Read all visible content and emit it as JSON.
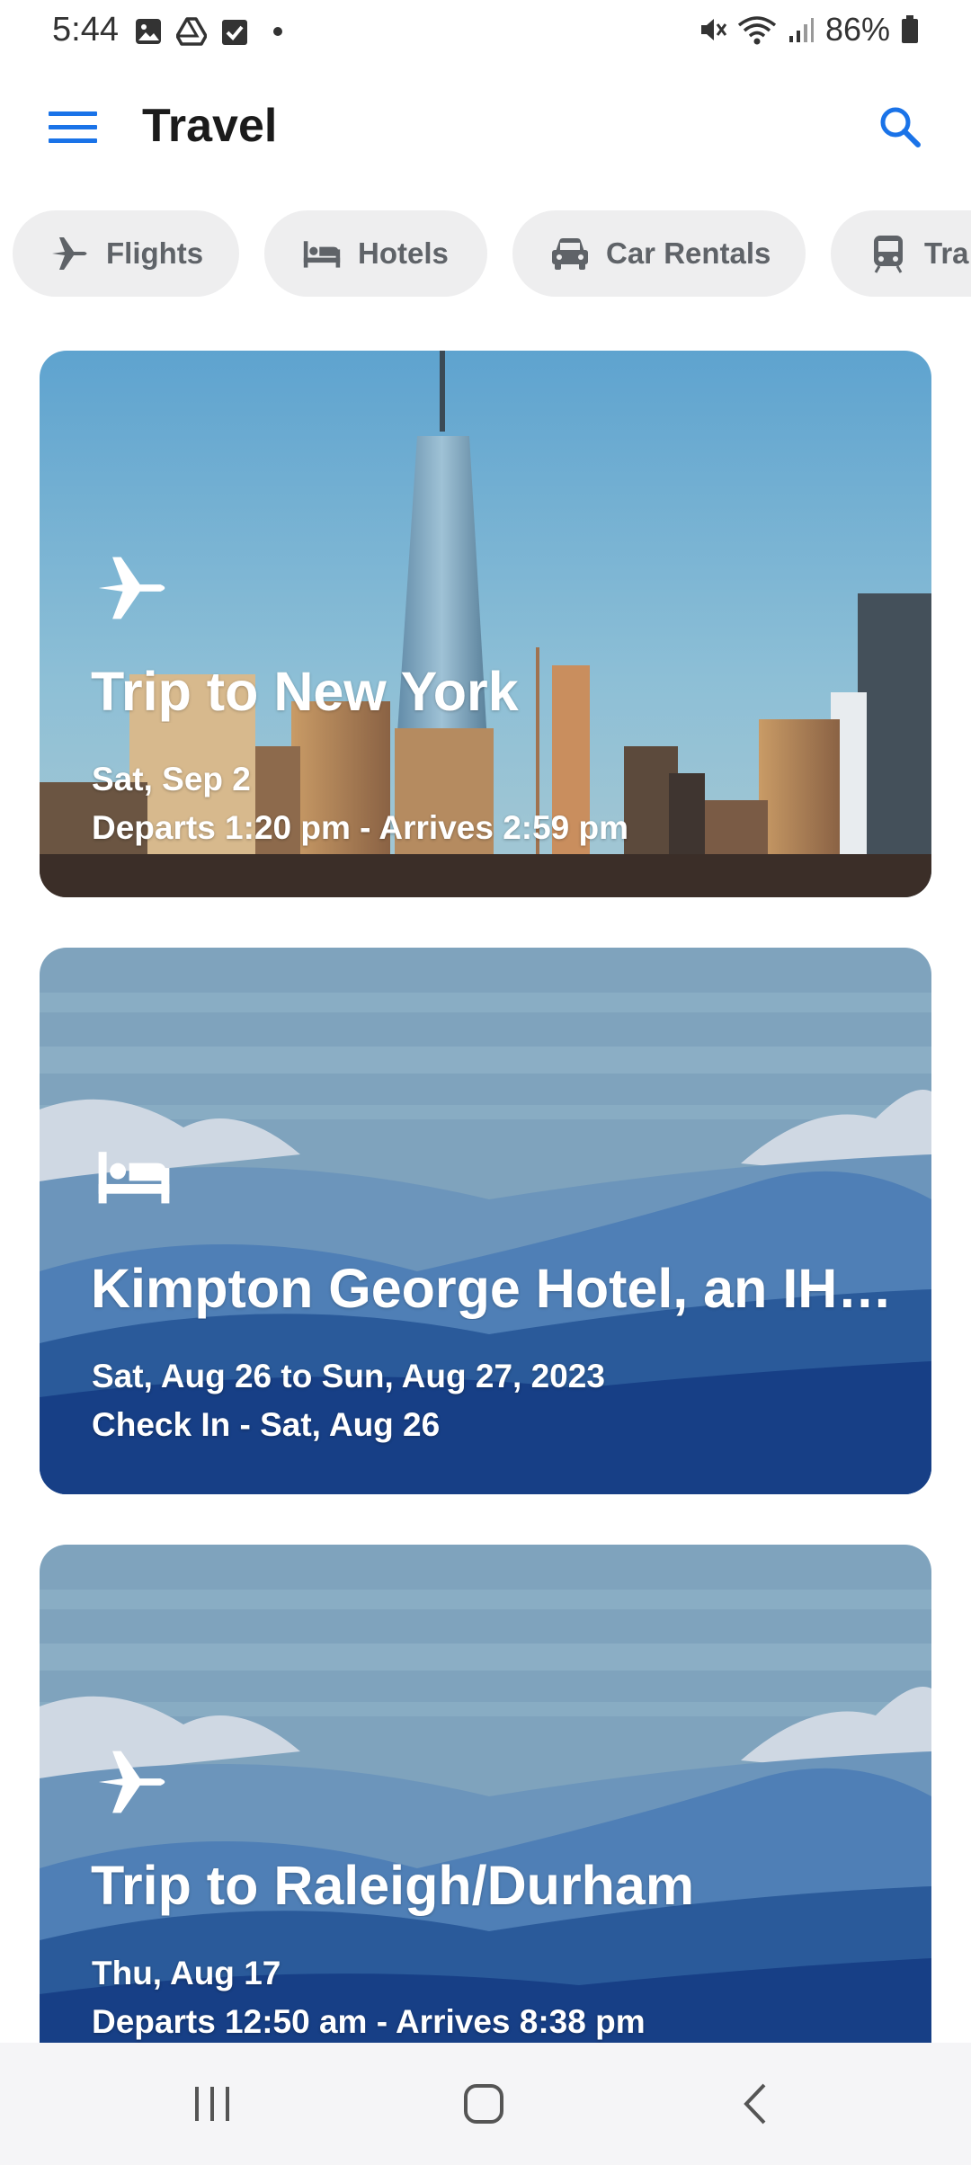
{
  "status_bar": {
    "time": "5:44",
    "battery": "86%",
    "left_icons": [
      "gallery-icon",
      "drive-icon",
      "tasks-icon",
      "dot-icon"
    ],
    "right_icons": [
      "mute-icon",
      "wifi-icon",
      "signal-icon",
      "battery-icon"
    ]
  },
  "app_bar": {
    "title": "Travel",
    "menu_icon": "hamburger-menu-icon",
    "search_icon": "search-icon",
    "accent": "#1a73e8"
  },
  "chips": [
    {
      "label": "Flights",
      "icon": "airplane-icon"
    },
    {
      "label": "Hotels",
      "icon": "bed-icon"
    },
    {
      "label": "Car Rentals",
      "icon": "car-icon"
    },
    {
      "label": "Tra",
      "icon": "train-icon"
    }
  ],
  "cards": [
    {
      "icon": "airplane-icon",
      "title": "Trip to New York",
      "line1": "Sat, Sep 2",
      "line2": "Departs 1:20 pm - Arrives 2:59 pm",
      "background": "city-skyline"
    },
    {
      "icon": "bed-icon",
      "title": "Kimpton George Hotel, an IHG…",
      "line1": "Sat, Aug 26 to Sun, Aug 27, 2023",
      "line2": "Check In - Sat, Aug 26",
      "background": "mountains"
    },
    {
      "icon": "airplane-icon",
      "title": "Trip to Raleigh/Durham",
      "line1": "Thu, Aug 17",
      "line2": "Departs 12:50 am - Arrives 8:38 pm",
      "background": "mountains"
    }
  ],
  "nav_bar": {
    "recents_icon": "recents-icon",
    "home_icon": "home-icon",
    "back_icon": "back-icon"
  }
}
